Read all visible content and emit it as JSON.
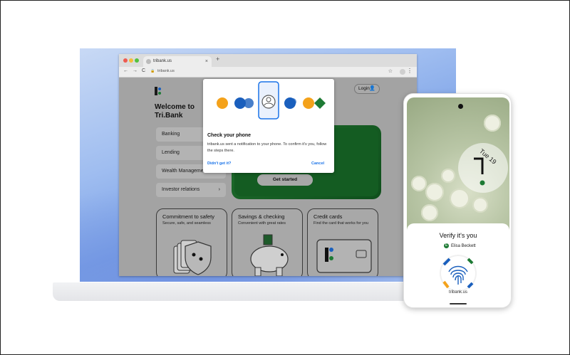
{
  "browser": {
    "tab_title": "tribank.us",
    "tab_close": "×",
    "new_tab": "+",
    "url": "tribank.us",
    "nav_back": "←",
    "nav_forward": "→",
    "nav_reload": "C",
    "bookmark": "☆",
    "menu": "⋮"
  },
  "site": {
    "welcome_line1": "Welcome to",
    "welcome_line2": "Tri.Bank",
    "login": "Login",
    "menu_items": [
      {
        "label": "Banking"
      },
      {
        "label": "Lending"
      },
      {
        "label": "Wealth Management"
      },
      {
        "label": "Investor relations",
        "chevron": "›"
      }
    ],
    "hero_cta": "Get started",
    "cards": [
      {
        "title": "Commitment to safety",
        "subtitle": "Secure, safe, and seamless"
      },
      {
        "title": "Savings & checking",
        "subtitle": "Convenient with great rates"
      },
      {
        "title": "Credit cards",
        "subtitle": "Find the card that works for you"
      }
    ]
  },
  "popup": {
    "title": "Check your phone",
    "message": "tribank.us sent a notification to your phone. To confirm it's you, follow the steps there.",
    "didnt_get_it": "Didn't get it?",
    "cancel": "Cancel"
  },
  "phone": {
    "date": "Tue 19",
    "verify_title": "Verify it's you",
    "account_initial": "E",
    "account_name": "Elisa Beckett",
    "domain": "tribank.us"
  },
  "colors": {
    "brand_green": "#1d7a34",
    "brand_blue": "#1a5fbd",
    "accent_orange": "#f4a21b",
    "link_blue": "#1a73e8"
  }
}
